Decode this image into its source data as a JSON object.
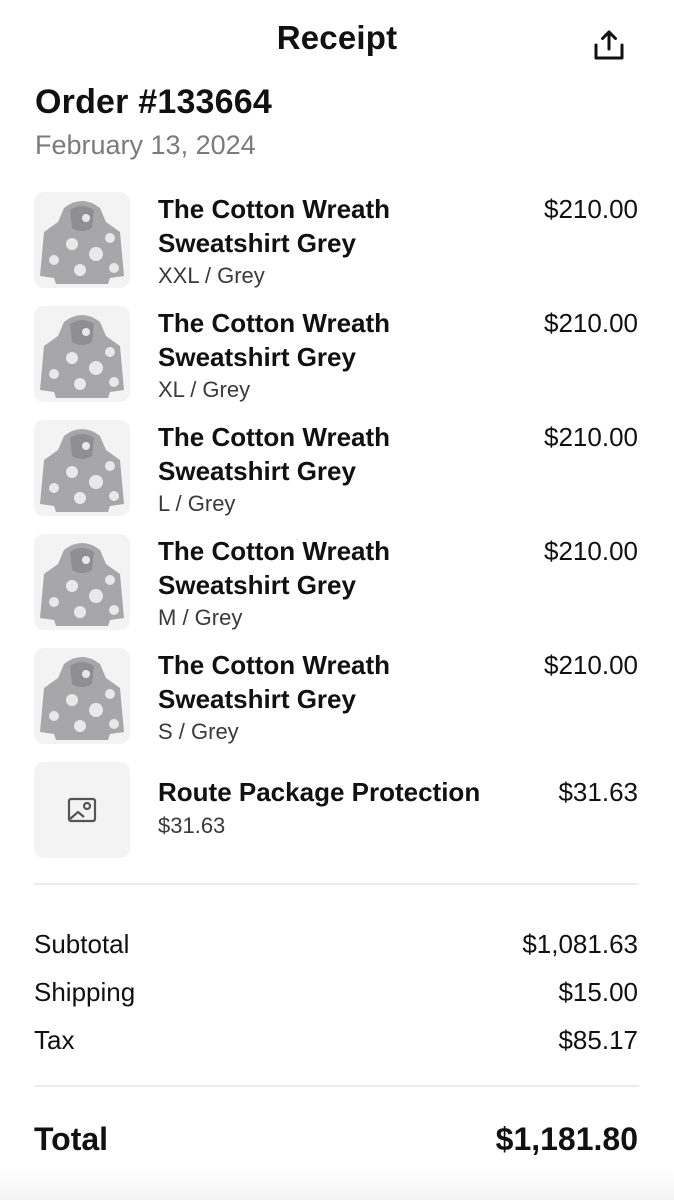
{
  "header": {
    "title": "Receipt",
    "share_icon": "share-icon"
  },
  "order": {
    "number": "Order #133664",
    "date": "February 13, 2024"
  },
  "items": [
    {
      "name": "The Cotton Wreath Sweatshirt Grey",
      "variant": "XXL / Grey",
      "price": "$210.00",
      "image": "grey-hoodie"
    },
    {
      "name": "The Cotton Wreath Sweatshirt Grey",
      "variant": "XL / Grey",
      "price": "$210.00",
      "image": "grey-hoodie"
    },
    {
      "name": "The Cotton Wreath Sweatshirt Grey",
      "variant": "L / Grey",
      "price": "$210.00",
      "image": "grey-hoodie"
    },
    {
      "name": "The Cotton Wreath Sweatshirt Grey",
      "variant": "M / Grey",
      "price": "$210.00",
      "image": "grey-hoodie"
    },
    {
      "name": "The Cotton Wreath Sweatshirt Grey",
      "variant": "S / Grey",
      "price": "$210.00",
      "image": "grey-hoodie"
    },
    {
      "name": "Route Package Protection",
      "variant": "$31.63",
      "price": "$31.63",
      "image": "image-placeholder-icon"
    }
  ],
  "summary": {
    "subtotal_label": "Subtotal",
    "subtotal_value": "$1,081.63",
    "shipping_label": "Shipping",
    "shipping_value": "$15.00",
    "tax_label": "Tax",
    "tax_value": "$85.17",
    "total_label": "Total",
    "total_value": "$1,181.80"
  },
  "colors": {
    "text": "#111111",
    "muted": "#7b7b7e",
    "divider": "#ececee",
    "thumb_bg": "#f3f3f4"
  }
}
